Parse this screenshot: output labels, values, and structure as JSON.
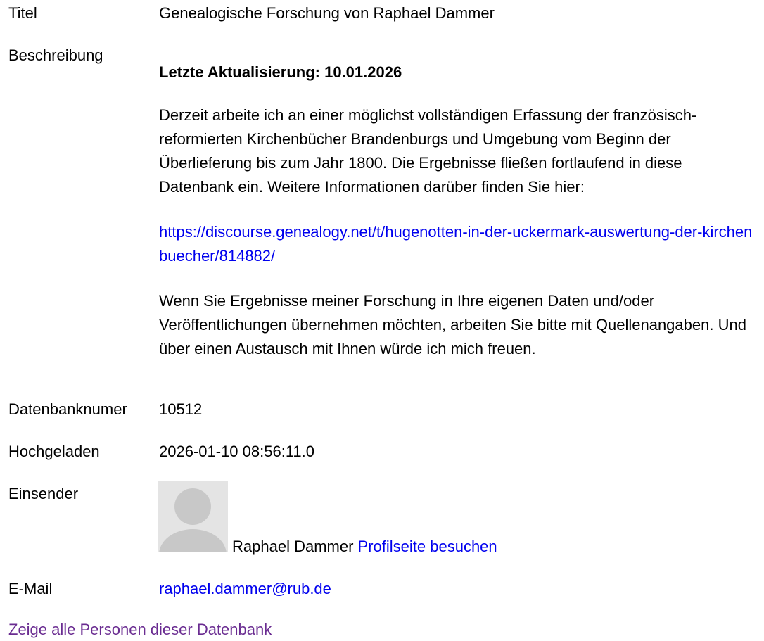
{
  "fields": {
    "title_label": "Titel",
    "title_value": "Genealogische Forschung von Raphael Dammer",
    "description_label": "Beschreibung",
    "db_number_label": "Datenbanknumer",
    "db_number_value": "10512",
    "uploaded_label": "Hochgeladen",
    "uploaded_value": "2026-01-10 08:56:11.0",
    "submitter_label": "Einsender",
    "submitter_name": "Raphael Dammer",
    "profile_link": "Profilseite besuchen",
    "email_label": "E-Mail",
    "email_value": "raphael.dammer@rub.de"
  },
  "description": {
    "heading": "Letzte Aktualisierung: 10.01.2026",
    "paragraph1": "Derzeit arbeite ich an einer möglichst vollständigen Erfassung der französisch-reformierten Kirchenbücher Brandenburgs und Umgebung vom Beginn der Überlieferung bis zum Jahr 1800. Die Ergebnisse fließen fortlaufend in diese Datenbank ein. Weitere Informationen darüber finden Sie hier:",
    "link": "https://discourse.genealogy.net/t/hugenotten-in-der-uckermark-auswertung-der-kirchenbuecher/814882/",
    "paragraph2": "Wenn Sie Ergebnisse meiner Forschung in Ihre eigenen Daten und/oder Veröffentlichungen übernehmen möchten, arbeiten Sie bitte mit Quellenangaben. Und über einen Austausch mit Ihnen würde ich mich freuen."
  },
  "footer": {
    "show_all_link": "Zeige alle Personen dieser Datenbank"
  },
  "colors": {
    "link": "#0000ee",
    "visited_link": "#6a2c91",
    "avatar_bg": "#e4e4e4",
    "avatar_figure": "#c8c8c8"
  }
}
